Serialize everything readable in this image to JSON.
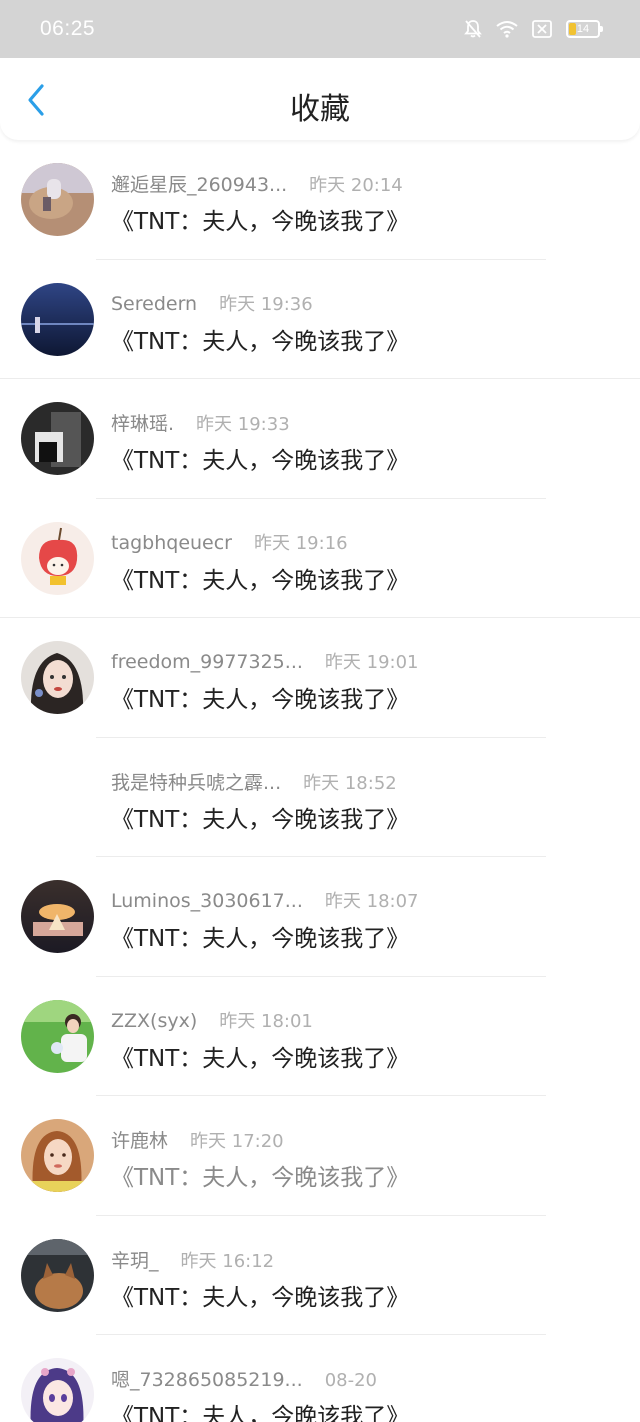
{
  "status_bar": {
    "time": "06:25",
    "battery_level": "14",
    "icons": [
      "bell-off-icon",
      "wifi-icon",
      "sim-x-icon",
      "battery-icon"
    ]
  },
  "header": {
    "title": "收藏",
    "back_icon": "chevron-left-icon"
  },
  "colors": {
    "status_bar_bg": "#d4d4d4",
    "accent_blue": "#2b9fe8",
    "battery_yellow": "#f1c232",
    "username_gray": "#8a8a8a",
    "time_gray": "#b0b0b0",
    "title_text": "#222222"
  },
  "items": [
    {
      "username": "邂逅星辰_260943...",
      "time": "昨天 20:14",
      "title": "《TNT：夫人，今晚该我了》"
    },
    {
      "username": "Seredern",
      "time": "昨天 19:36",
      "title": "《TNT：夫人，今晚该我了》"
    },
    {
      "username": "梓琳瑶.",
      "time": "昨天 19:33",
      "title": "《TNT：夫人，今晚该我了》"
    },
    {
      "username": "tagbhqeuecr",
      "time": "昨天 19:16",
      "title": "《TNT：夫人，今晚该我了》"
    },
    {
      "username": "freedom_9977325...",
      "time": "昨天 19:01",
      "title": "《TNT：夫人，今晚该我了》"
    },
    {
      "username": "我是特种兵唬之霹...",
      "time": "昨天 18:52",
      "title": "《TNT：夫人，今晚该我了》"
    },
    {
      "username": "Luminos_3030617...",
      "time": "昨天 18:07",
      "title": "《TNT：夫人，今晚该我了》"
    },
    {
      "username": "ZZX(syx)",
      "time": "昨天 18:01",
      "title": "《TNT：夫人，今晚该我了》"
    },
    {
      "username": "许鹿林",
      "time": "昨天 17:20",
      "title": "《TNT：夫人，今晚该我了》"
    },
    {
      "username": "辛玥_",
      "time": "昨天 16:12",
      "title": "《TNT：夫人，今晚该我了》"
    },
    {
      "username": "嗯_732865085219...",
      "time": "08-20",
      "title": "《TNT：夫人，今晚该我了》"
    }
  ]
}
